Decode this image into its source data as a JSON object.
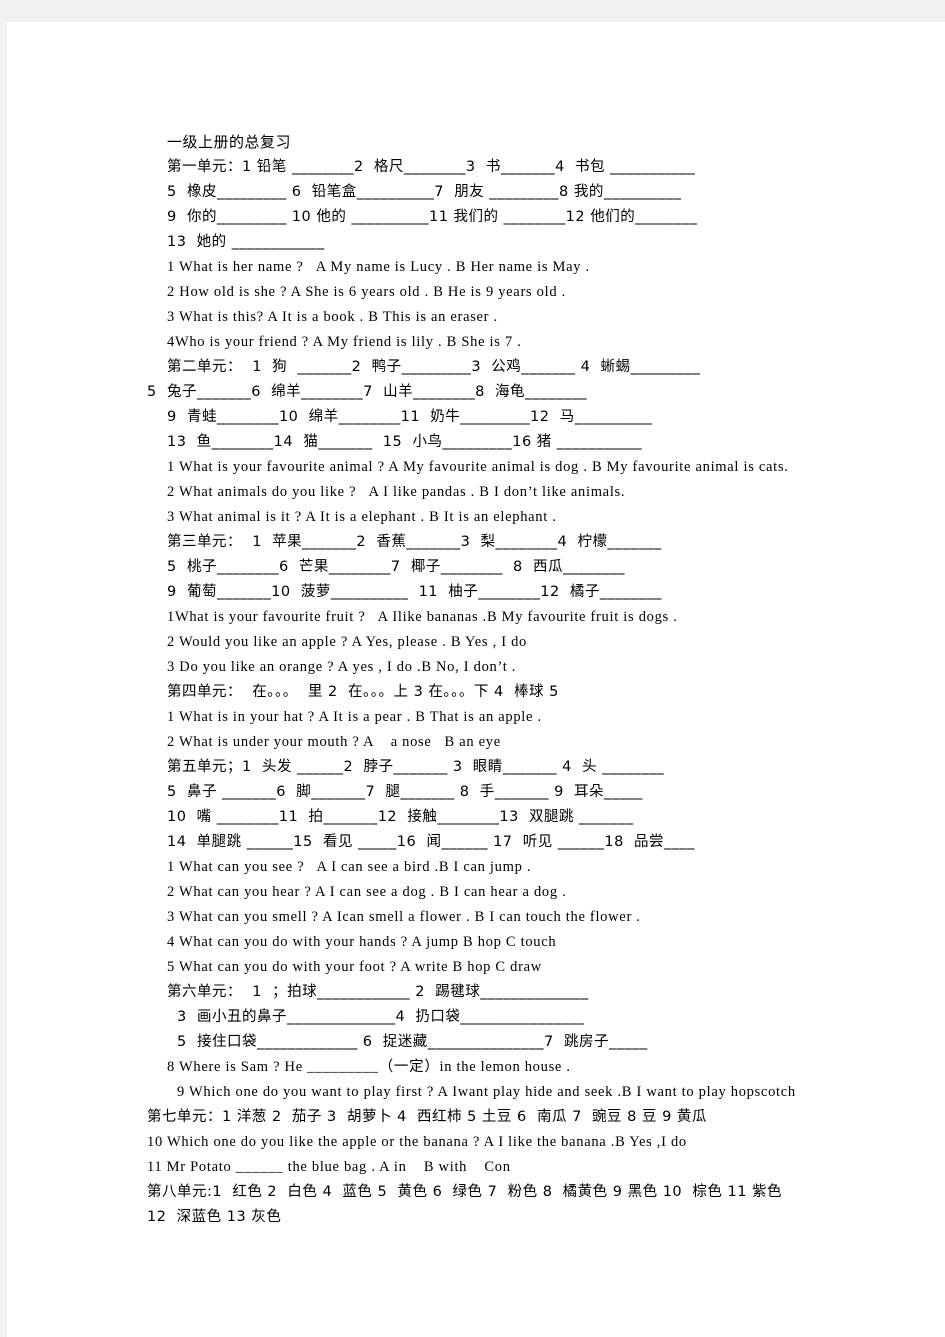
{
  "document": {
    "title": "一级上册的总复习",
    "page_background": "#ffffff",
    "margin_background": "#f2f2f2",
    "text_color": "#000000"
  },
  "units": {
    "unit1": {
      "heading": "第一单元：",
      "vocab_lines": [
        "第一单元：1 铅笔 ________2  格尺________3  书_______4  书包 ___________",
        "5  橡皮_________ 6  铅笔盒__________7  朋友 _________8 我的__________",
        "9  你的_________ 10 他的 __________11 我们的 ________12 他们的________",
        "13  她的 ____________"
      ],
      "questions": [
        "1 What is her name ?   A My name is Lucy . B Her name is May .",
        "2 How old is she ? A She is 6 years old . B He is 9 years old .",
        "3 What is this? A It is a book . B This is an eraser .",
        "4Who is your friend ? A My friend is lily . B She is 7 ."
      ]
    },
    "unit2": {
      "heading": "第二单元：",
      "vocab_lines": [
        "第二单元：  1  狗  _______2  鸭子_________3  公鸡_______ 4  蜥蜴_________",
        "5  兔子_______6  绵羊________7  山羊________8  海龟________",
        "9  青蛙________10  绵羊________11  奶牛_________12  马__________",
        "13  鱼________14  猫_______  15  小鸟_________16 猪 ___________"
      ],
      "questions": [
        "1 What is your favourite animal ? A My favourite animal is dog . B My favourite animal is cats.",
        "2 What animals do you like ?   A I like pandas . B I don’t like animals.",
        "3 What animal is it ? A It is a elephant . B It is an elephant ."
      ]
    },
    "unit3": {
      "heading": "第三单元：",
      "vocab_lines": [
        "第三单元：  1  苹果_______2  香蕉_______3  梨________4  柠檬_______",
        "5  桃子________6  芒果________7  椰子________  8  西瓜________",
        "9  葡萄_______10  菠萝__________  11  柚子________12  橘子________"
      ],
      "questions": [
        "1What is your favourite fruit ?   A Ilike bananas .B My favourite fruit is dogs .",
        "2 Would you like an apple ? A Yes, please . B Yes , I do",
        "3 Do you like an orange ? A yes , I do .B No, I don’t ."
      ]
    },
    "unit4": {
      "heading": "第四单元：",
      "vocab_lines": [
        "第四单元：  在。。。  里 2  在。。。上 3 在。。。下 4  棒球 5"
      ],
      "questions": [
        "1 What is in your hat ? A It is a pear . B That is an apple .",
        "2 What is under your mouth ? A    a nose   B an eye"
      ]
    },
    "unit5": {
      "heading": "第五单元；",
      "vocab_lines": [
        "第五单元；1  头发 ______2  脖子_______ 3  眼睛_______ 4  头 ________",
        "5  鼻子 _______6  脚_______7  腿_______ 8  手_______ 9  耳朵_____",
        "10  嘴 ________11  拍_______12  接触________13  双腿跳 _______",
        "14  单腿跳 ______15  看见 _____16  闻______ 17  听见 ______18  品尝____"
      ],
      "questions": [
        "1 What can you see ?   A I can see a bird .B I can jump .",
        "2 What can you hear ? A I can see a dog . B I can hear a dog .",
        "3 What can you smell ? A Ican smell a flower . B I can touch the flower .",
        "4 What can you do with your hands ? A jump B hop C touch",
        "5 What can you do with your foot ? A write B hop C draw"
      ]
    },
    "unit6": {
      "heading": "第六单元：",
      "vocab_lines": [
        "第六单元：  1  ；拍球____________ 2  踢毽球______________",
        "3  画小丑的鼻子______________4  扔口袋________________",
        "5  接住口袋_____________ 6  捉迷藏_______________7  跳房子_____",
        "8 Where is Sam ? He _________（一定）in the lemon house .",
        "9 Which one do you want to play first ? A Iwant play hide and seek .B I want to play hopscotch"
      ]
    },
    "unit7": {
      "heading": "第七单元：",
      "vocab_lines": [
        "第七单元：1 洋葱 2  茄子 3  胡萝卜 4  西红柿 5 土豆 6  南瓜 7  豌豆 8 豆 9 黄瓜"
      ],
      "questions": [
        "10 Which one do you like the apple or the banana ? A I like the banana .B Yes ,I do",
        "11 Mr Potato ______ the blue bag . A in    B with    Con"
      ]
    },
    "unit8": {
      "heading": "第八单元:",
      "vocab_lines": [
        "第八单元:1  红色 2  白色 4  蓝色 5  黄色 6  绿色 7  粉色 8  橘黄色 9 黑色 10  棕色 11 紫色",
        "12  深蓝色 13 灰色"
      ]
    }
  },
  "lines": [
    {
      "id": "title",
      "kind": "cn",
      "indent": 0,
      "text": "一级上册的总复习"
    },
    {
      "id": "u1-v1",
      "kind": "mix",
      "indent": 0,
      "text": "第一单元：1 铅笔 ________2  格尺________3  书_______4  书包 ___________"
    },
    {
      "id": "u1-v2",
      "kind": "mix",
      "indent": 0,
      "text": "5  橡皮_________ 6  铅笔盒__________7  朋友 _________8 我的__________"
    },
    {
      "id": "u1-v3",
      "kind": "mix",
      "indent": 0,
      "text": "9  你的_________ 10 他的 __________11 我们的 ________12 他们的________"
    },
    {
      "id": "u1-v4",
      "kind": "mix",
      "indent": 0,
      "text": "13  她的 ____________"
    },
    {
      "id": "u1-q1",
      "kind": "en",
      "indent": 0,
      "text": "1 What is her name ?   A My name is Lucy . B Her name is May ."
    },
    {
      "id": "u1-q2",
      "kind": "en",
      "indent": 0,
      "text": "2 How old is she ? A She is 6 years old . B He is 9 years old ."
    },
    {
      "id": "u1-q3",
      "kind": "en",
      "indent": 0,
      "text": "3 What is this? A It is a book . B This is an eraser ."
    },
    {
      "id": "u1-q4",
      "kind": "en",
      "indent": 0,
      "text": "4Who is your friend ? A My friend is lily . B She is 7 ."
    },
    {
      "id": "u2-v1",
      "kind": "mix",
      "indent": 0,
      "text": "第二单元：  1  狗  _______2  鸭子_________3  公鸡_______ 4  蜥蜴_________"
    },
    {
      "id": "u2-v2",
      "kind": "mix",
      "indent": -20,
      "text": "5  兔子_______6  绵羊________7  山羊________8  海龟________"
    },
    {
      "id": "u2-v3",
      "kind": "mix",
      "indent": 0,
      "text": "9  青蛙________10  绵羊________11  奶牛_________12  马__________"
    },
    {
      "id": "u2-v4",
      "kind": "mix",
      "indent": 0,
      "text": "13  鱼________14  猫_______  15  小鸟_________16 猪 ___________"
    },
    {
      "id": "u2-q1",
      "kind": "en",
      "indent": 0,
      "text": "1 What is your favourite animal ? A My favourite animal is dog . B My favourite animal is cats."
    },
    {
      "id": "u2-q2",
      "kind": "en",
      "indent": 0,
      "text": "2 What animals do you like ?   A I like pandas . B I don’t like animals."
    },
    {
      "id": "u2-q3",
      "kind": "en",
      "indent": 0,
      "text": "3 What animal is it ? A It is a elephant . B It is an elephant ."
    },
    {
      "id": "u3-v1",
      "kind": "mix",
      "indent": 0,
      "text": "第三单元：  1  苹果_______2  香蕉_______3  梨________4  柠檬_______"
    },
    {
      "id": "u3-v2",
      "kind": "mix",
      "indent": 0,
      "text": "5  桃子________6  芒果________7  椰子________  8  西瓜________"
    },
    {
      "id": "u3-v3",
      "kind": "mix",
      "indent": 0,
      "text": "9  葡萄_______10  菠萝__________  11  柚子________12  橘子________"
    },
    {
      "id": "u3-q1",
      "kind": "en",
      "indent": 0,
      "text": "1What is your favourite fruit ?   A Ilike bananas .B My favourite fruit is dogs ."
    },
    {
      "id": "u3-q2",
      "kind": "en",
      "indent": 0,
      "text": "2 Would you like an apple ? A Yes, please . B Yes , I do"
    },
    {
      "id": "u3-q3",
      "kind": "en",
      "indent": 0,
      "text": "3 Do you like an orange ? A yes , I do .B No, I don’t ."
    },
    {
      "id": "u4-v1",
      "kind": "mix",
      "indent": 0,
      "text": "第四单元：  在。。。  里 2  在。。。上 3 在。。。下 4  棒球 5"
    },
    {
      "id": "u4-q1",
      "kind": "en",
      "indent": 0,
      "text": "1 What is in your hat ? A It is a pear . B That is an apple ."
    },
    {
      "id": "u4-q2",
      "kind": "en",
      "indent": 0,
      "text": "2 What is under your mouth ? A    a nose   B an eye"
    },
    {
      "id": "u5-v1",
      "kind": "mix",
      "indent": 0,
      "text": "第五单元；1  头发 ______2  脖子_______ 3  眼睛_______ 4  头 ________"
    },
    {
      "id": "u5-v2",
      "kind": "mix",
      "indent": 0,
      "text": "5  鼻子 _______6  脚_______7  腿_______ 8  手_______ 9  耳朵_____"
    },
    {
      "id": "u5-v3",
      "kind": "mix",
      "indent": 0,
      "text": "10  嘴 ________11  拍_______12  接触________13  双腿跳 _______"
    },
    {
      "id": "u5-v4",
      "kind": "mix",
      "indent": 0,
      "text": "14  单腿跳 ______15  看见 _____16  闻______ 17  听见 ______18  品尝____"
    },
    {
      "id": "u5-q1",
      "kind": "en",
      "indent": 0,
      "text": "1 What can you see ?   A I can see a bird .B I can jump ."
    },
    {
      "id": "u5-q2",
      "kind": "en",
      "indent": 0,
      "text": "2 What can you hear ? A I can see a dog . B I can hear a dog ."
    },
    {
      "id": "u5-q3",
      "kind": "en",
      "indent": 0,
      "text": "3 What can you smell ? A Ican smell a flower . B I can touch the flower ."
    },
    {
      "id": "u5-q4",
      "kind": "en",
      "indent": 0,
      "text": "4 What can you do with your hands ? A jump B hop C touch"
    },
    {
      "id": "u5-q5",
      "kind": "en",
      "indent": 0,
      "text": "5 What can you do with your foot ? A write B hop C draw"
    },
    {
      "id": "u6-v1",
      "kind": "mix",
      "indent": 0,
      "text": "第六单元：  1  ；拍球____________ 2  踢毽球______________"
    },
    {
      "id": "u6-v2",
      "kind": "mix",
      "indent": 10,
      "text": "3  画小丑的鼻子______________4  扔口袋________________"
    },
    {
      "id": "u6-v3",
      "kind": "mix",
      "indent": 10,
      "text": "5  接住口袋_____________ 6  捉迷藏_______________7  跳房子_____"
    },
    {
      "id": "u6-q1",
      "kind": "en",
      "indent": 0,
      "text": "8 Where is Sam ? He _________（一定）in the lemon house ."
    },
    {
      "id": "u6-q2",
      "kind": "en",
      "indent": 10,
      "text": "9 Which one do you want to play first ? A Iwant play hide and seek .B I want to play hopscotch"
    },
    {
      "id": "u7-v1",
      "kind": "mix",
      "indent": -20,
      "text": "第七单元：1 洋葱 2  茄子 3  胡萝卜 4  西红柿 5 土豆 6  南瓜 7  豌豆 8 豆 9 黄瓜"
    },
    {
      "id": "u7-q1",
      "kind": "en",
      "indent": -20,
      "text": "10 Which one do you like the apple or the banana ? A I like the banana .B Yes ,I do"
    },
    {
      "id": "u7-q2",
      "kind": "en",
      "indent": -20,
      "text": "11 Mr Potato ______ the blue bag . A in    B with    Con"
    },
    {
      "id": "u8-v1",
      "kind": "mix",
      "indent": -20,
      "text": "第八单元:1  红色 2  白色 4  蓝色 5  黄色 6  绿色 7  粉色 8  橘黄色 9 黑色 10  棕色 11 紫色"
    },
    {
      "id": "u8-v2",
      "kind": "mix",
      "indent": -20,
      "text": "12  深蓝色 13 灰色"
    }
  ]
}
